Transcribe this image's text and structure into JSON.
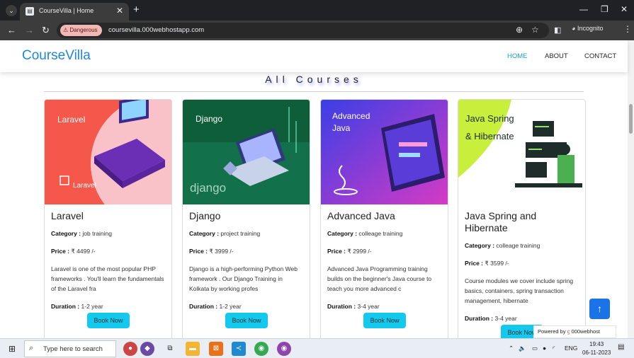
{
  "browser": {
    "tab_title": "CourseVilla | Home",
    "security_chip": "Dangerous",
    "url": "coursevilla.000webhostapp.com",
    "incognito_label": "Incognito"
  },
  "site": {
    "brand": "CourseVilla",
    "nav": [
      "HOME",
      "ABOUT",
      "CONTACT"
    ],
    "section_title": "All Courses"
  },
  "labels": {
    "category": "Category :",
    "price": "Price :",
    "duration": "Duration :",
    "book": "Book Now"
  },
  "courses": [
    {
      "image_caption": "Laravel",
      "image_caption_2": "Laravel",
      "title": "Laravel",
      "category": "job training",
      "price": "₹ 4499 /-",
      "description": "Laravel is one of the most popular PHP frameworks . You'll learn the fundamentals of the Laravel fra",
      "duration": "1-2 year",
      "book_label": "Book Now",
      "colors": [
        "#f5574b",
        "#f9c1c8"
      ]
    },
    {
      "image_caption": "Django",
      "image_caption_2": "django",
      "title": "Django",
      "category": "project training",
      "price": "₹ 3999 /-",
      "description": "Django is a high-performing Python Web framework . Our Django Training in Kolkata by working profes",
      "duration": "1-2 year",
      "book_label": "Book Now",
      "colors": [
        "#0e5e3a",
        "#1a8a57"
      ]
    },
    {
      "image_caption": "Advanced Java",
      "title": "Advanced Java",
      "category": "colleage training",
      "price": "₹ 2999 /-",
      "description": "Advanced Java Programming training builds on the beginner's Java course to teach you more advanced c",
      "duration": "3-4 year",
      "book_label": "Book Now",
      "colors": [
        "#3a3fe6",
        "#d63ac5"
      ]
    },
    {
      "image_caption": "Java Spring & Hibernate",
      "title": "Java Spring and Hibernate",
      "category": "colleage training",
      "price": "₹ 3599 /-",
      "description": "Course modules we cover include spring basics, containers, spring transaction management, hibernate",
      "duration": "3-4 year",
      "book_label": "Book Now",
      "colors": [
        "#c9ef3d",
        "#ffffff"
      ]
    }
  ],
  "widgets": {
    "powered_by": "Powered by",
    "host": "000webhost"
  },
  "taskbar": {
    "search_placeholder": "Type here to search",
    "lang": "ENG",
    "time": "19:43",
    "date": "06-11-2023"
  },
  "icons": [
    "tab-search-icon",
    "close-icon",
    "plus-icon",
    "back-arrow-icon",
    "forward-arrow-icon",
    "reload-icon",
    "warning-icon",
    "zoom-icon",
    "star-icon",
    "sidepanel-icon",
    "incognito-icon",
    "menu-icon",
    "arrow-up-icon",
    "windows-icon",
    "search-icon"
  ]
}
